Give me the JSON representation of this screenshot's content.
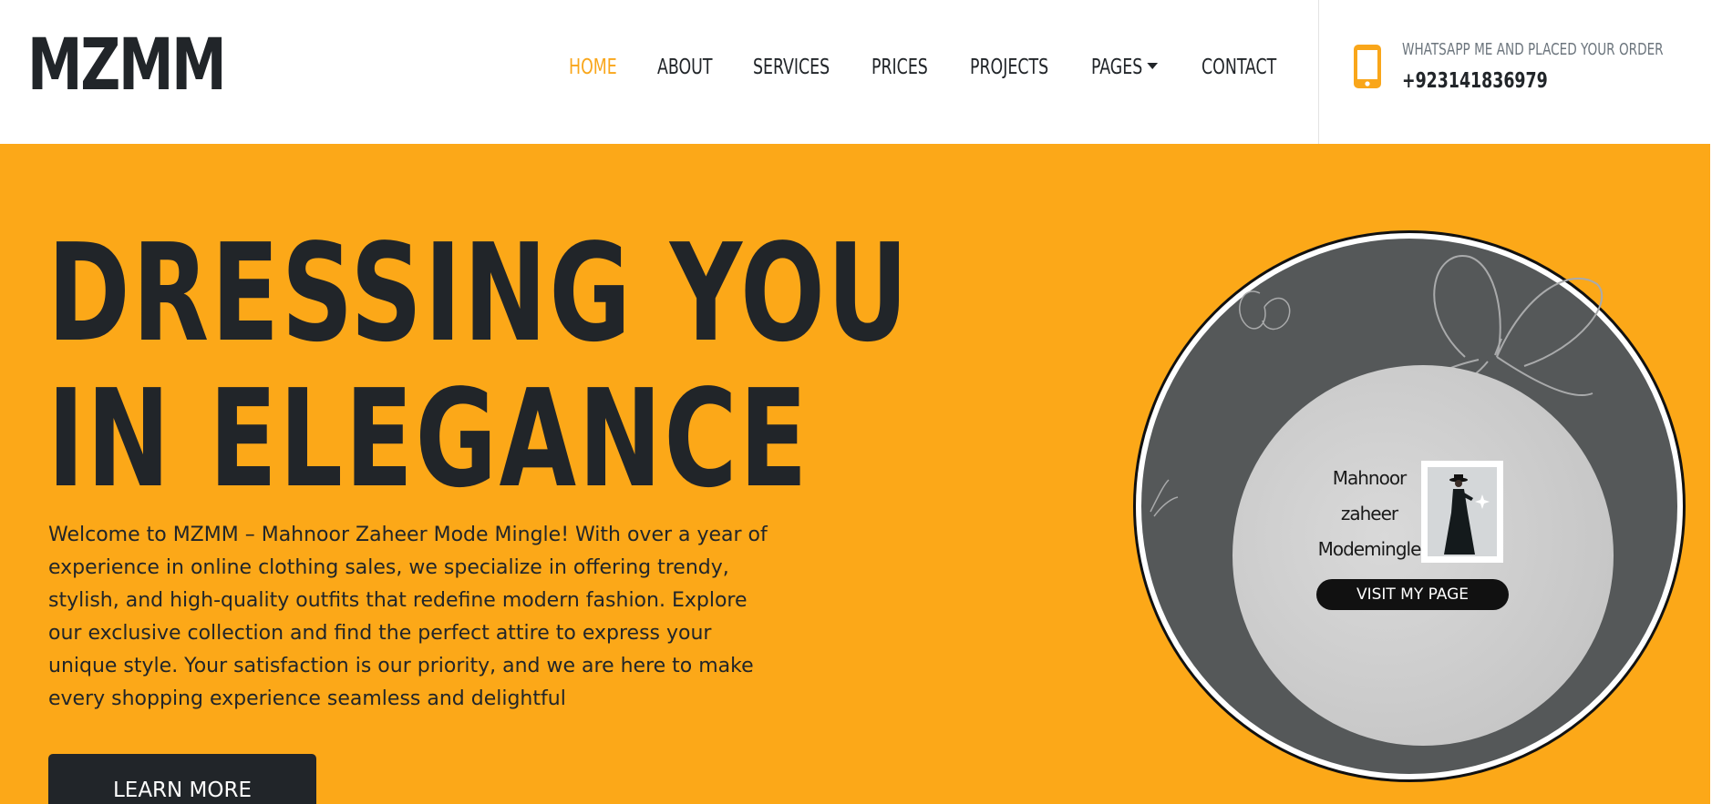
{
  "brand": {
    "logo": "MZMM"
  },
  "nav": {
    "items": [
      {
        "label": "HOME",
        "active": true
      },
      {
        "label": "ABOUT",
        "active": false
      },
      {
        "label": "SERVICES",
        "active": false
      },
      {
        "label": "PRICES",
        "active": false
      },
      {
        "label": "PROJECTS",
        "active": false
      },
      {
        "label": "PAGES",
        "active": false,
        "dropdown": true
      },
      {
        "label": "CONTACT",
        "active": false
      }
    ]
  },
  "contact": {
    "icon": "mobile-phone-icon",
    "label": "WHATSAPP ME AND PLACED YOUR ORDER",
    "phone": "+923141836979"
  },
  "hero": {
    "title_line1": "DRESSING YOU",
    "title_line2": "IN ELEGANCE",
    "text": "Welcome to MZMM – Mahnoor Zaheer Mode Mingle! With over a year of experience in online clothing sales, we specialize in offering trendy, stylish, and high-quality outfits that redefine modern fashion. Explore our exclusive collection and find the perfect attire to express your unique style. Your satisfaction is our priority, and we are here to make every shopping experience seamless and delightful",
    "button": "LEARN MORE"
  },
  "card": {
    "name_lines": [
      "Mahnoor",
      "zaheer",
      "Modemingle"
    ],
    "button": "VISIT MY PAGE"
  },
  "colors": {
    "accent": "#f9a61a",
    "hero_bg": "#fca818",
    "dark": "#212529",
    "circle_dark": "#555859"
  }
}
